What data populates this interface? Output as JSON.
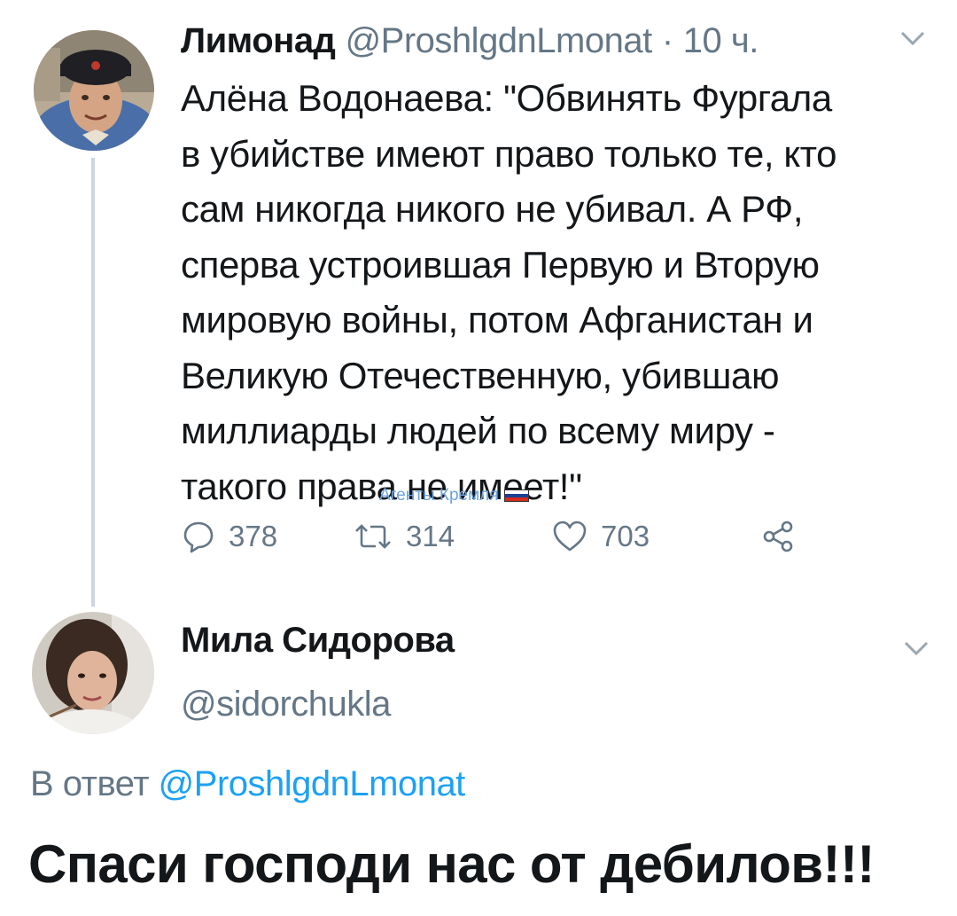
{
  "tweet": {
    "author_name": "Лимонад",
    "author_handle": "@ProshlgdnLmonat",
    "separator": "·",
    "time": "10 ч.",
    "text_lines": [
      "Алёна Водонаева: \"Обвинять Фургала",
      "в убийстве имеют право только те, кто",
      "сам никогда никого не убивал. А РФ,",
      "сперва устроившая Первую и Вторую",
      "мировую войны, потом Афганистан и",
      "Великую Отечественную, убившаю",
      "миллиарды людей по всему миру -",
      "такого права не имеет!\""
    ],
    "reply_count": "378",
    "retweet_count": "314",
    "like_count": "703",
    "icons": {
      "reply": "reply-bubble-icon",
      "retweet": "retweet-icon",
      "like": "heart-icon",
      "share": "share-icon",
      "menu": "chevron-down-icon"
    }
  },
  "watermark": {
    "text": "Агенты Кремля",
    "flag_colors": [
      "#ffffff",
      "#1c3f94",
      "#d52b1e"
    ]
  },
  "reply": {
    "author_name": "Мила Сидорова",
    "author_handle": "@sidorchukla",
    "reply_to_prefix": "В ответ",
    "reply_to_handle": "@ProshlgdnLmonat",
    "text": "Спаси господи нас от дебилов!!!"
  },
  "colors": {
    "text": "#14171a",
    "secondary": "#657786",
    "link": "#1da1f2",
    "thread_line": "#ccd6dd",
    "watermark": "#6ba3e0"
  }
}
